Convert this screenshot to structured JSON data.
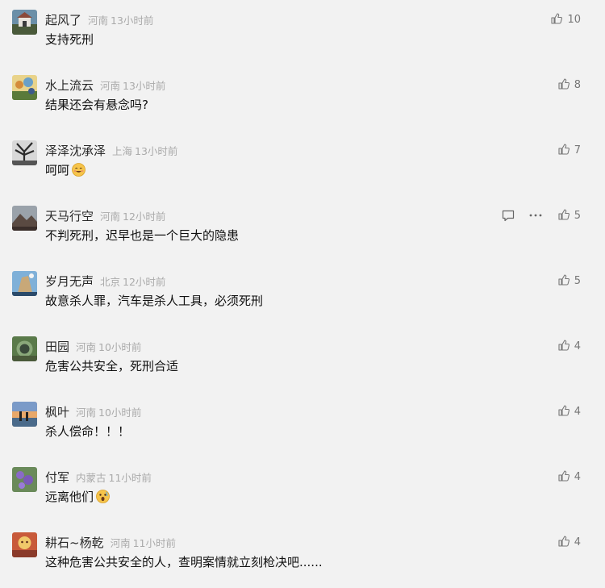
{
  "comments": [
    {
      "name": "起风了",
      "region": "河南",
      "time": "13小时前",
      "text": "支持死刑",
      "likes": "10",
      "avatar": "avatar-house"
    },
    {
      "name": "水上流云",
      "region": "河南",
      "time": "13小时前",
      "text": "结果还会有悬念吗?",
      "likes": "8",
      "avatar": "avatar-flowers"
    },
    {
      "name": "泽泽沈承泽",
      "region": "上海",
      "time": "13小时前",
      "text": "呵呵",
      "likes": "7",
      "avatar": "avatar-tree",
      "emoji": "smile"
    },
    {
      "name": "天马行空",
      "region": "河南",
      "time": "12小时前",
      "text": "不判死刑，迟早也是一个巨大的隐患",
      "likes": "5",
      "avatar": "avatar-mountain",
      "hover": true
    },
    {
      "name": "岁月无声",
      "region": "北京",
      "time": "12小时前",
      "text": "故意杀人罪，汽车是杀人工具，必须死刑",
      "likes": "5",
      "avatar": "avatar-sky"
    },
    {
      "name": "田园",
      "region": "河南",
      "time": "10小时前",
      "text": "危害公共安全，死刑合适",
      "likes": "4",
      "avatar": "avatar-garden"
    },
    {
      "name": "枫叶",
      "region": "河南",
      "time": "10小时前",
      "text": "杀人偿命！！！",
      "likes": "4",
      "avatar": "avatar-sunset"
    },
    {
      "name": "付军",
      "region": "内蒙古",
      "time": "11小时前",
      "text": "远离他们",
      "likes": "4",
      "avatar": "avatar-lavender",
      "emoji": "shock"
    },
    {
      "name": "耕石~杨乾",
      "region": "河南",
      "time": "11小时前",
      "text": "这种危害公共安全的人，查明案情就立刻枪决吧......",
      "likes": "4",
      "avatar": "avatar-warm"
    }
  ],
  "colors": {
    "background": "#f2f2f2",
    "muted": "#aaaaaa",
    "icon": "#777777"
  }
}
